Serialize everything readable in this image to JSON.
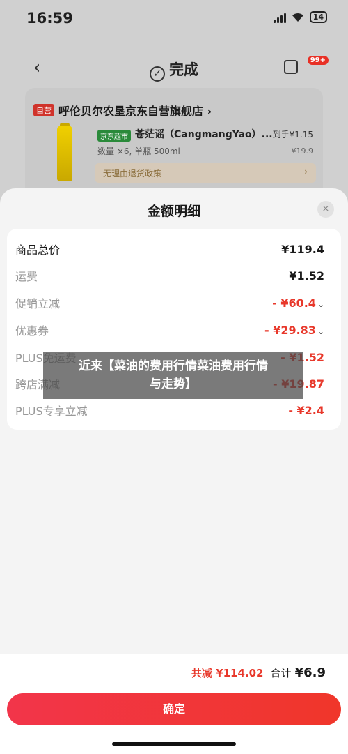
{
  "status_bar": {
    "time": "16:59",
    "battery": "14"
  },
  "header": {
    "title": "完成",
    "badge": "99+"
  },
  "store": {
    "tag": "自营",
    "name": "呼伦贝尔农垦京东自营旗舰店 ›",
    "shop_tag": "京东超市",
    "product_title": "苍茫谣（CangmangYao）...",
    "price_label": "到手¥1.15",
    "meta": "数量 ×6, 单瓶 500ml",
    "orig_price": "¥19.9",
    "policy": "无理由退货政策",
    "policy_arrow": "›"
  },
  "sheet": {
    "title": "金额明细",
    "close": "×",
    "rows": [
      {
        "label": "商品总价",
        "value": "¥119.4"
      },
      {
        "label": "运费",
        "value": "¥1.52"
      },
      {
        "label": "促销立减",
        "value": "- ¥60.4"
      },
      {
        "label": "优惠券",
        "value": "- ¥29.83"
      },
      {
        "label": "PLUS免运费",
        "value": "- ¥1.52"
      },
      {
        "label": "跨店满减",
        "value": "- ¥19.87"
      },
      {
        "label": "PLUS专享立减",
        "value": "- ¥2.4"
      }
    ]
  },
  "watermark": {
    "line1": "近来【菜油的费用行情菜油费用行情",
    "line2": "与走势】"
  },
  "bottom": {
    "discount": "共减 ¥114.02",
    "total_label": "合计",
    "total_value": "¥6.9",
    "confirm_label": "确定"
  },
  "colors": {
    "accent": "#e8382b",
    "button": "#f2354a"
  },
  "icons": [
    "back-icon",
    "check-circle-icon",
    "share-icon",
    "close-icon",
    "chevron-down-icon"
  ]
}
